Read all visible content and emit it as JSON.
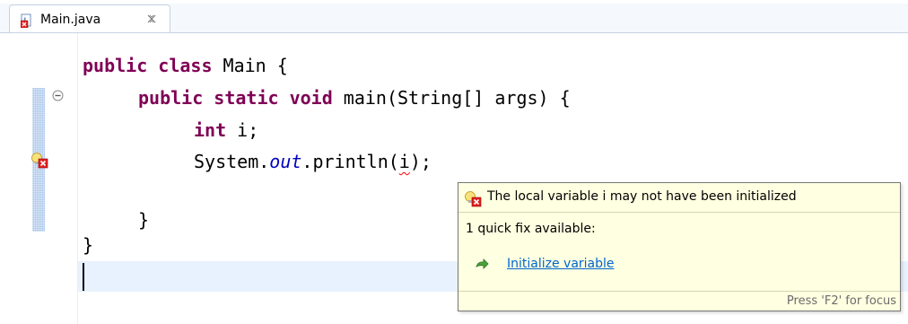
{
  "editor": {
    "tab": {
      "label": "Main.java",
      "icon": "java-file-error-icon",
      "close_icon": "close-icon"
    },
    "code": {
      "line1": {
        "kw1": "public",
        "kw2": "class",
        "rest": " Main {"
      },
      "line2": {
        "kw1": "public",
        "kw2": "static",
        "kw3": "void",
        "rest": " main(String[] args) {"
      },
      "line3": {
        "kw1": "int",
        "rest": " i;"
      },
      "line4": {
        "pre": "System.",
        "field": "out",
        "mid": ".println(",
        "err": "i",
        "post": ");"
      },
      "line6": "}",
      "line7": "}"
    },
    "gutter": {
      "fold_icon": "collapse-icon",
      "error_icon": "error-lightbulb-icon"
    }
  },
  "hover": {
    "message": "The local variable i may not have been initialized",
    "fix_count": "1 quick fix available:",
    "fixes": [
      {
        "label": "Initialize variable",
        "icon": "change-arrow-icon"
      }
    ],
    "hint": "Press 'F2' for focus"
  },
  "colors": {
    "keyword": "#7f0055",
    "field": "#0000c0",
    "link": "#0066cc",
    "hover_bg": "#ffffe1",
    "current_line": "#e8f2fe",
    "error": "#e02020"
  }
}
